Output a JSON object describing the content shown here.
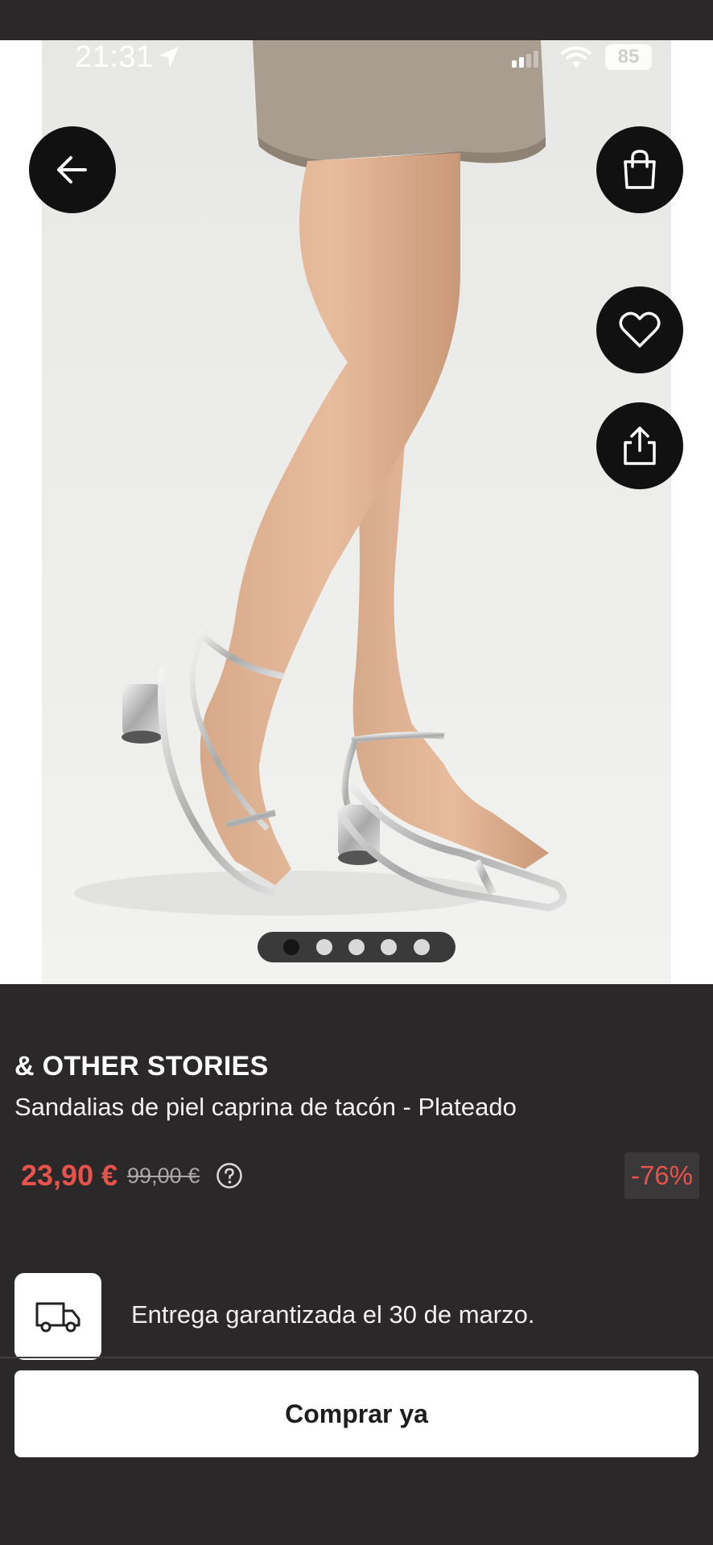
{
  "status_bar": {
    "time": "21:31",
    "battery": "85",
    "location_icon": "location-arrow-icon",
    "signal_icon": "signal-icon",
    "wifi_icon": "wifi-icon"
  },
  "gallery": {
    "image_alt": "Sandalias de piel caprina de tacón - Plateado",
    "total_images": 5,
    "active_index": 0,
    "back_icon": "arrow-left-icon",
    "bag_icon": "shopping-bag-icon",
    "favorite_icon": "heart-icon",
    "share_icon": "share-icon"
  },
  "product": {
    "brand": "& OTHER STORIES",
    "title": "Sandalias de piel caprina de tacón - Plateado",
    "price": "23,90 €",
    "original_price": "99,00 €",
    "discount": "-76%",
    "help_icon": "question-circle-icon"
  },
  "delivery": {
    "icon": "truck-icon",
    "text": "Entrega garantizada el 30 de marzo."
  },
  "actions": {
    "buy_now": "Comprar ya"
  },
  "colors": {
    "background": "#2a2829",
    "price_red": "#e5534d",
    "button_bg": "#ffffff",
    "icon_button_bg": "#111111"
  }
}
